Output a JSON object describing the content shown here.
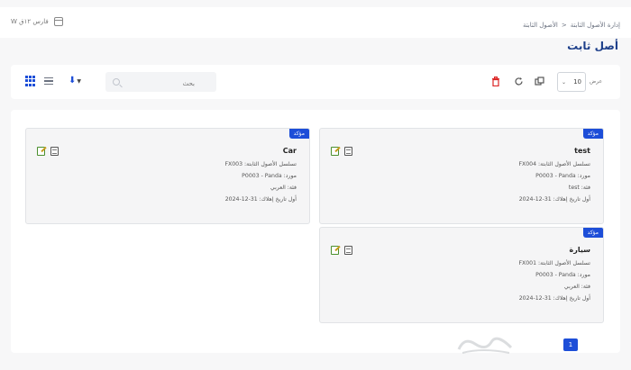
{
  "header": {
    "date_text": "W فارس ١٢ق",
    "breadcrumb": [
      "إدارة الأصول الثابتة",
      "الأصول الثابتة"
    ],
    "breadcrumb_sep": "<",
    "title": "أصل ثابت"
  },
  "toolbar": {
    "search_placeholder": "بحث",
    "per_page_value": "10",
    "per_page_label": "عرض"
  },
  "cards": [
    {
      "badge": "مؤكد",
      "title": "test",
      "lines": [
        "تسلسل الأصول الثابتة: FX004",
        "مورد: P0003 - Panda",
        "فئة: test",
        "أول تاريخ إهلاك: 31-12-2024"
      ]
    },
    {
      "badge": "مؤكد",
      "title": "Car",
      "lines": [
        "تسلسل الأصول الثابتة: FX003",
        "مورد: P0003 - Panda",
        "فئة: العربي",
        "أول تاريخ إهلاك: 31-12-2024"
      ]
    },
    {
      "badge": "مؤكد",
      "title": "سيارة",
      "lines": [
        "تسلسل الأصول الثابتة: FX001",
        "مورد: P0003 - Panda",
        "فئة: العربي",
        "أول تاريخ إهلاك: 31-12-2024"
      ]
    }
  ],
  "pagination": {
    "current": "1"
  },
  "colors": {
    "primary": "#1d4ed8",
    "title": "#1d3f8a",
    "danger": "#dc2626"
  },
  "icons": [
    "grid-view-icon",
    "list-view-icon",
    "download-icon",
    "search-icon",
    "trash-icon",
    "refresh-icon",
    "copy-icon",
    "edit-icon",
    "view-icon",
    "calendar-icon"
  ]
}
